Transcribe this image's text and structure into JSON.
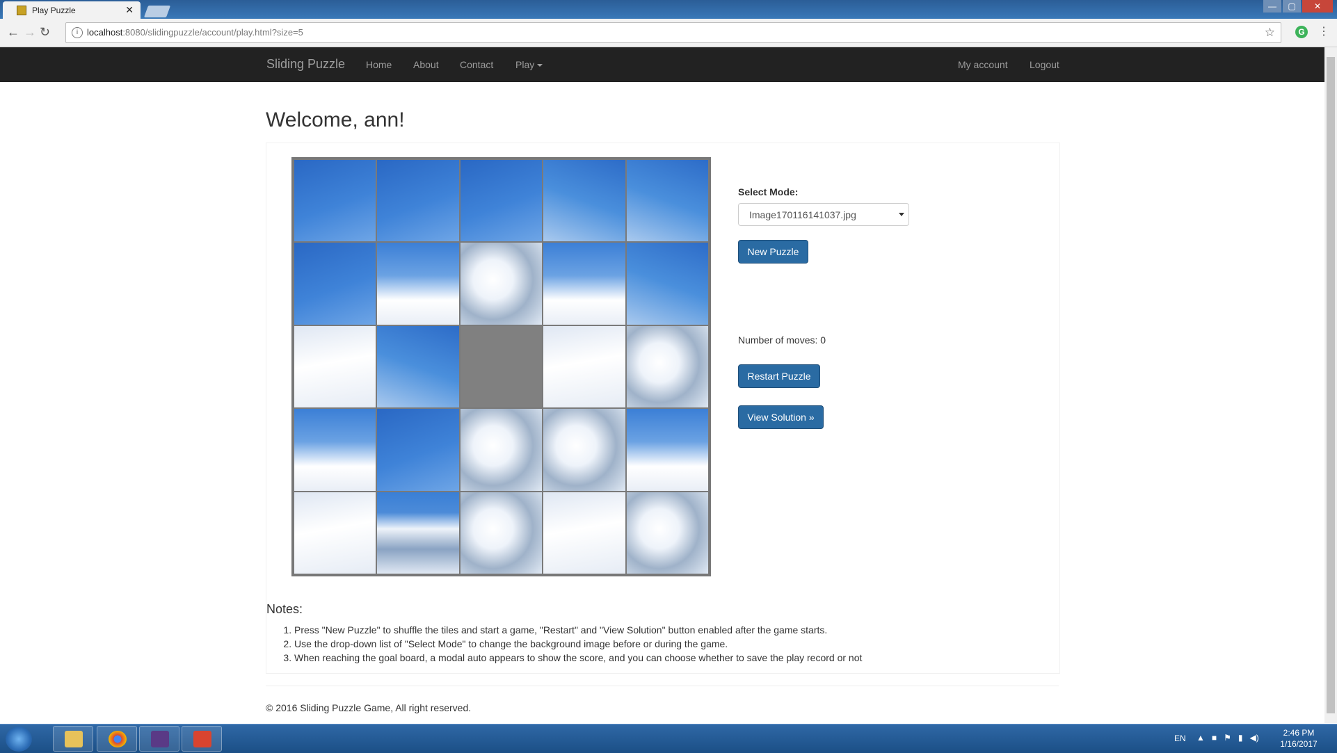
{
  "browser": {
    "tab_title": "Play Puzzle",
    "tab_close": "✕",
    "url_host": "localhost",
    "url_rest": ":8080/slidingpuzzle/account/play.html?size=5",
    "window_controls": [
      "—",
      "▢",
      "✕"
    ]
  },
  "navbar": {
    "brand": "Sliding Puzzle",
    "links": [
      "Home",
      "About",
      "Contact",
      "Play"
    ],
    "right_links": [
      "My account",
      "Logout"
    ]
  },
  "main": {
    "welcome": "Welcome, ann!",
    "board": {
      "size": 5,
      "empty_position": [
        2,
        2
      ]
    },
    "controls": {
      "select_label": "Select Mode:",
      "select_value": "Image170116141037.jpg",
      "new_puzzle": "New Puzzle",
      "moves_text": "Number of moves: 0",
      "restart": "Restart Puzzle",
      "view_solution": "View Solution »"
    },
    "notes": {
      "heading": "Notes:",
      "items": [
        "Press \"New Puzzle\" to shuffle the tiles and start a game, \"Restart\" and \"View Solution\" button enabled after the game starts.",
        "Use the drop-down list of \"Select Mode\" to change the background image before or during the game.",
        "When reaching the goal board, a modal auto appears to show the score, and you can choose whether to save the play record or not"
      ]
    },
    "footer": "© 2016 Sliding Puzzle Game, All right reserved."
  },
  "taskbar": {
    "lang": "EN",
    "time": "2:46 PM",
    "date": "1/16/2017"
  },
  "colors": {
    "navbar_bg": "#222222",
    "button_bg": "#2a6ba3",
    "empty_tile": "#808080"
  }
}
